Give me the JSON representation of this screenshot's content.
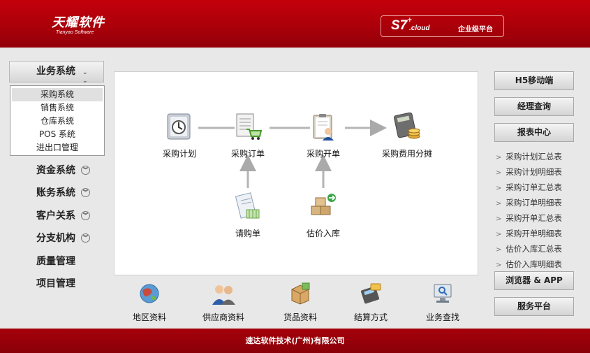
{
  "header": {
    "logo_main": "天耀软件",
    "logo_sub": "Tianyao Software",
    "platform_s7": "S7",
    "platform_plus": "+",
    "platform_cloud": ".cloud",
    "platform_label": "企业级平台"
  },
  "sidebar": {
    "active_system": "业务系统",
    "submenu": [
      "采购系统",
      "销售系统",
      "仓库系统",
      "POS 系统",
      "进出口管理"
    ],
    "submenu_active_index": 0,
    "items": [
      {
        "label": "资金系统",
        "expandable": true
      },
      {
        "label": "账务系统",
        "expandable": true
      },
      {
        "label": "客户关系",
        "expandable": true
      },
      {
        "label": "分支机构",
        "expandable": true
      },
      {
        "label": "质量管理",
        "expandable": false
      },
      {
        "label": "项目管理",
        "expandable": false
      }
    ]
  },
  "flow": {
    "plan": "采购计划",
    "order": "采购订单",
    "open": "采购开单",
    "cost": "采购费用分摊",
    "request": "请购单",
    "estimate": "估价入库"
  },
  "tools": [
    "地区资料",
    "供应商资料",
    "货品资料",
    "结算方式",
    "业务查找"
  ],
  "right": {
    "h5": "H5移动端",
    "manager": "经理查询",
    "report": "报表中心",
    "reports": [
      "采购计划汇总表",
      "采购计划明细表",
      "采购订单汇总表",
      "采购订单明细表",
      "采购开单汇总表",
      "采购开单明细表",
      "估价入库汇总表",
      "估价入库明细表"
    ],
    "browser": "浏览器 & APP",
    "service": "服务平台"
  },
  "footer": {
    "company": "速达软件技术(广州)有限公司"
  }
}
